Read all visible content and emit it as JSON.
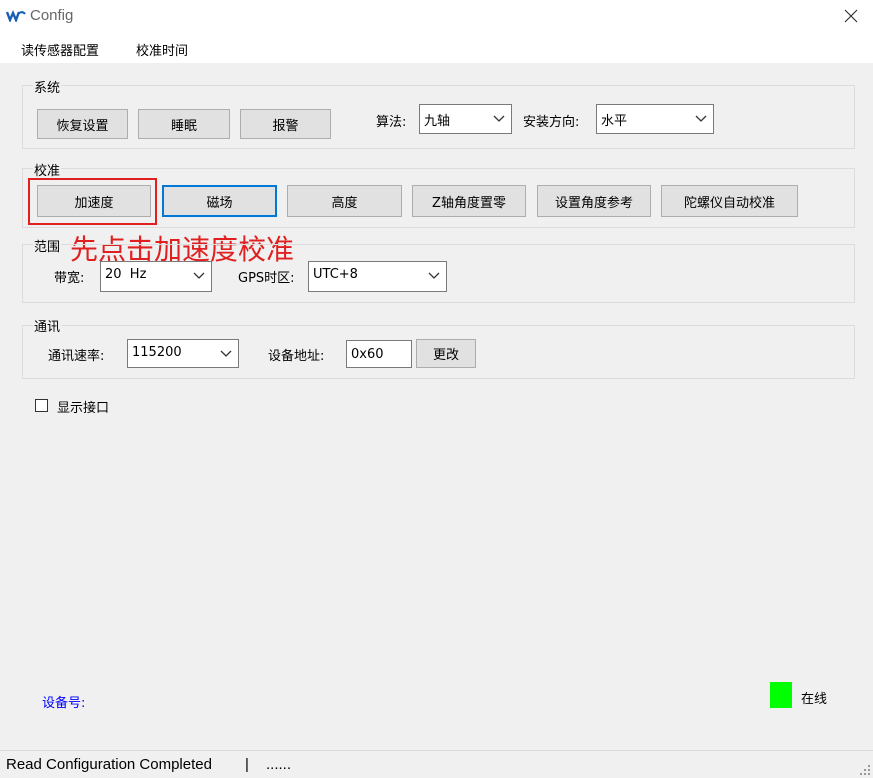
{
  "window": {
    "title": "Config"
  },
  "menu": {
    "items": [
      "读传感器配置",
      "校准时间"
    ]
  },
  "system": {
    "label": "系统",
    "buttons": [
      "恢复设置",
      "睡眠",
      "报警"
    ],
    "algorithm_label": "算法:",
    "algorithm_value": "九轴",
    "mount_label": "安装方向:",
    "mount_value": "水平"
  },
  "calibration": {
    "label": "校准",
    "buttons": [
      "加速度",
      "磁场",
      "高度",
      "Z轴角度置零",
      "设置角度参考",
      "陀螺仪自动校准"
    ]
  },
  "annotation": {
    "text": "先点击加速度校准",
    "color": "#e02020"
  },
  "range": {
    "label": "范围",
    "bandwidth_label": "带宽:",
    "bandwidth_value": "20  Hz",
    "gps_label": "GPS时区:",
    "gps_value": "UTC+8"
  },
  "comm": {
    "label": "通讯",
    "baud_label": "通讯速率:",
    "baud_value": "115200",
    "address_label": "设备地址:",
    "address_value": "0x60",
    "change_button": "更改"
  },
  "show_port": {
    "label": "显示接口",
    "checked": false
  },
  "device": {
    "label": "设备号:",
    "label_color": "#0000ff"
  },
  "online": {
    "label": "在线",
    "indicator_color": "#00ff00"
  },
  "status": {
    "message": "Read Configuration Completed",
    "separator": "|",
    "extra": "......"
  }
}
